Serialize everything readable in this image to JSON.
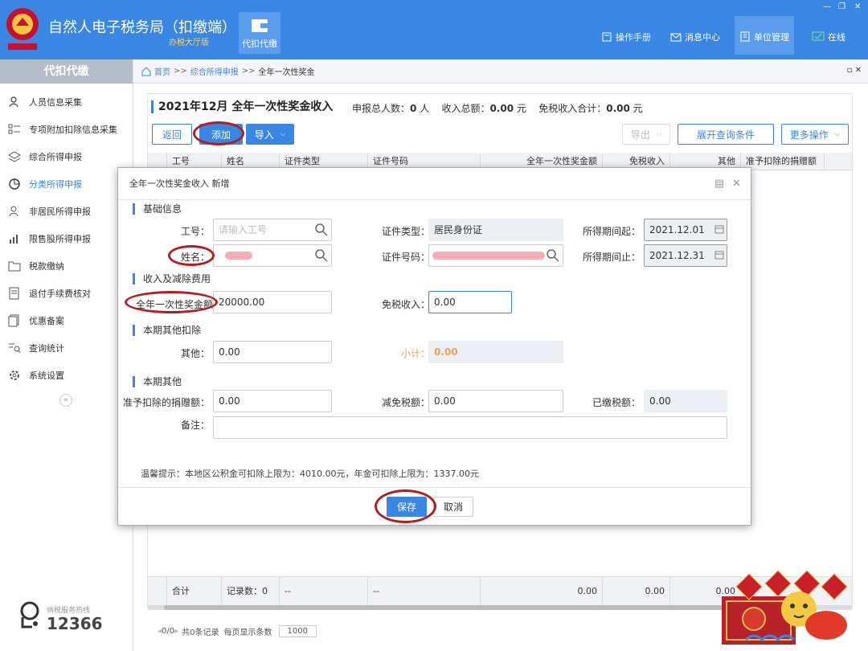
{
  "app": {
    "title": "自然人电子税务局（扣缴端）",
    "subtitle": "办税大厅版"
  },
  "top_tile": {
    "label": "代扣代缴"
  },
  "top_nav": [
    {
      "label": "操作手册",
      "icon": "book-icon"
    },
    {
      "label": "消息中心",
      "icon": "mail-icon"
    },
    {
      "label": "单位管理",
      "icon": "building-icon"
    },
    {
      "label": "在线",
      "icon": "monitor-check-icon"
    }
  ],
  "sidebar": {
    "header": "代扣代缴",
    "items": [
      {
        "label": "人员信息采集",
        "icon": "person-icon"
      },
      {
        "label": "专项附加扣除信息采集",
        "icon": "list-icon"
      },
      {
        "label": "综合所得申报",
        "icon": "layers-icon"
      },
      {
        "label": "分类所得申报",
        "icon": "pie-icon"
      },
      {
        "label": "非居民所得申报",
        "icon": "person-outline-icon"
      },
      {
        "label": "限售股所得申报",
        "icon": "bar-chart-icon"
      },
      {
        "label": "税款缴纳",
        "icon": "folder-icon"
      },
      {
        "label": "退付手续费核对",
        "icon": "document-icon"
      },
      {
        "label": "优惠备案",
        "icon": "copy-icon"
      },
      {
        "label": "查询统计",
        "icon": "query-icon"
      },
      {
        "label": "系统设置",
        "icon": "gear-icon"
      }
    ],
    "collapse": "«",
    "hotline_label": "纳税服务热线",
    "hotline_number": "12366"
  },
  "breadcrumb": {
    "home": "首页",
    "sep": ">>",
    "level2": "综合所得申报",
    "current": "全年一次性奖金"
  },
  "panel": {
    "title": "2021年12月  全年一次性奖金收入",
    "stats_prefix": "申报总人数：",
    "count": "0",
    "count_unit": "人",
    "income_prefix": "收入总额：",
    "income": "0.00",
    "income_unit": "元",
    "exempt_prefix": "免税收入合计：",
    "exempt": "0.00",
    "exempt_unit": "元",
    "buttons": {
      "back": "返回",
      "add": "添加",
      "import": "导入",
      "export": "导出",
      "expand": "展开查询条件",
      "more": "更多操作"
    },
    "columns": [
      "",
      "工号",
      "姓名",
      "证件类型",
      "证件号码",
      "全年一次性奖金额",
      "免税收入",
      "其他",
      "准予扣除的捐赠额"
    ],
    "footer": {
      "label": "合计",
      "records": "记录数：0",
      "dash1": "--",
      "dash2": "--",
      "v1": "0.00",
      "v2": "0.00",
      "v3": "0.00"
    }
  },
  "pager": {
    "pages": "0/0",
    "summary": "共0条记录",
    "per_page_label": "每页显示条数",
    "per_page": "1000"
  },
  "modal": {
    "title": "全年一次性奖金收入 新增",
    "sections": {
      "basic": "基础信息",
      "income": "收入及减除费用",
      "deduct": "本期其他扣除",
      "other": "本期其他"
    },
    "fields": {
      "emp_no": {
        "label": "工号：",
        "placeholder": "请输入工号"
      },
      "name": {
        "label": "姓名："
      },
      "id_type": {
        "label": "证件类型：",
        "value": "居民身份证"
      },
      "id_no": {
        "label": "证件号码："
      },
      "period_start": {
        "label": "所得期间起：",
        "value": "2021.12.01"
      },
      "period_end": {
        "label": "所得期间止：",
        "value": "2021.12.31"
      },
      "bonus": {
        "label": "全年一次性奖金额",
        "value": "20000.00"
      },
      "exempt": {
        "label": "免税收入：",
        "value": "0.00"
      },
      "other": {
        "label": "其他：",
        "value": "0.00"
      },
      "subtotal": {
        "label": "小计：",
        "value": "0.00"
      },
      "donation": {
        "label": "准予扣除的捐赠额：",
        "value": "0.00"
      },
      "tax_relief": {
        "label": "减免税额：",
        "value": "0.00"
      },
      "tax_paid": {
        "label": "已缴税额：",
        "value": "0.00"
      },
      "remark": {
        "label": "备注：",
        "value": ""
      }
    },
    "tip": "温馨提示：本地区公积金可扣除上限为：4010.00元，年金可扣除上限为：1337.00元",
    "buttons": {
      "save": "保存",
      "cancel": "取消"
    }
  },
  "colors": {
    "brand": "#3a86e4",
    "highlight": "#b51c1c"
  }
}
